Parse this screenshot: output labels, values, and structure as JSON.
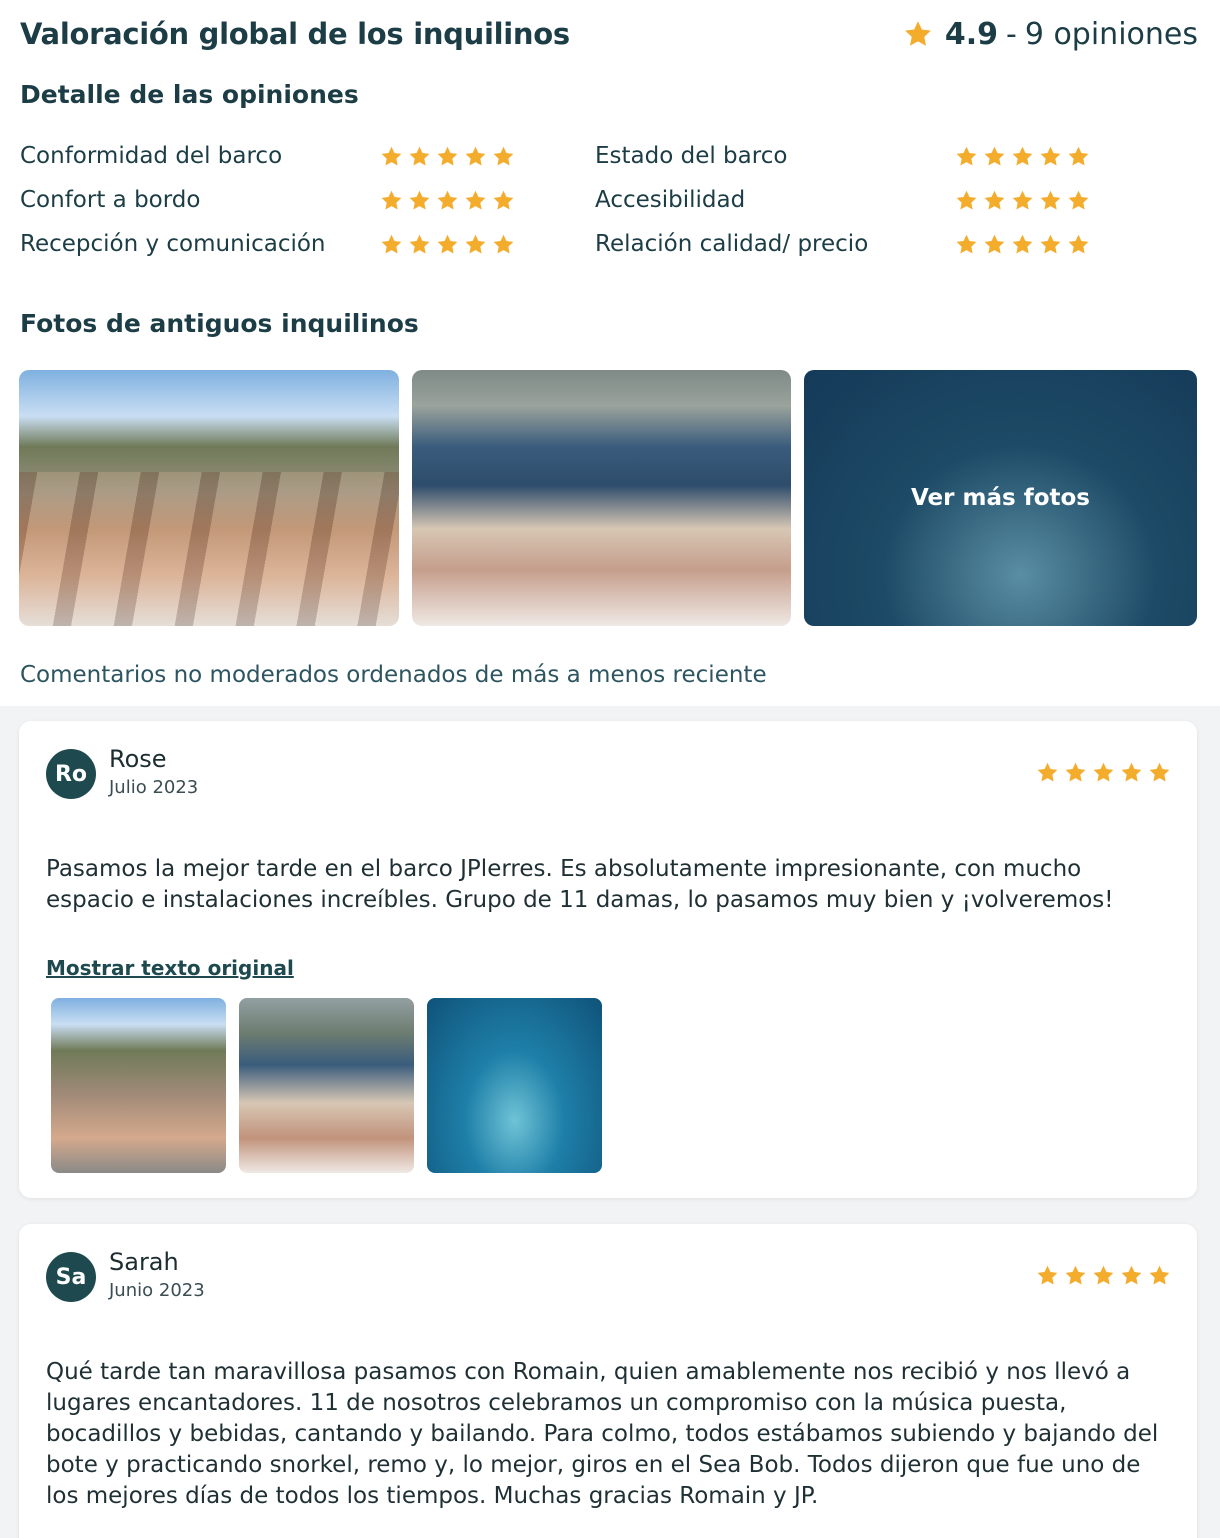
{
  "header": {
    "title": "Valoración global de los inquilinos",
    "score": "4.9",
    "separator": "-",
    "count": "9 opiniones"
  },
  "detail": {
    "title": "Detalle de las opiniones",
    "criteria": [
      {
        "label": "Conformidad del barco",
        "rating": 5
      },
      {
        "label": "Estado del barco",
        "rating": 5
      },
      {
        "label": "Confort a bordo",
        "rating": 5
      },
      {
        "label": "Accesibilidad",
        "rating": 5
      },
      {
        "label": "Recepción y comunicación",
        "rating": 5
      },
      {
        "label": "Relación calidad/ precio",
        "rating": 5
      }
    ]
  },
  "photos": {
    "title": "Fotos de antiguos inquilinos",
    "more_label": "Ver más fotos"
  },
  "sort_note": "Comentarios no moderados ordenados de más a menos reciente",
  "colors": {
    "star": "#f3ac2c",
    "accent": "#1e4a4f"
  },
  "reviews": [
    {
      "initials": "Ro",
      "author": "Rose",
      "date": "Julio 2023",
      "rating": 5,
      "text": "Pasamos la mejor tarde en el barco JPlerres. Es absolutamente impresionante, con mucho espacio e instalaciones increíbles. Grupo de 11 damas, lo pasamos muy bien y ¡volveremos!",
      "show_original": "Mostrar texto original"
    },
    {
      "initials": "Sa",
      "author": "Sarah",
      "date": "Junio 2023",
      "rating": 5,
      "text": "Qué tarde tan maravillosa pasamos con Romain, quien amablemente nos recibió y nos llevó a lugares encantadores. 11 de nosotros celebramos un compromiso con la música puesta, bocadillos y bebidas, cantando y bailando. Para colmo, todos estábamos subiendo y bajando del bote y practicando snorkel, remo y, lo mejor, giros en el Sea Bob. Todos dijeron que fue uno de los mejores días de todos los tiempos. Muchas gracias Romain y JP."
    }
  ]
}
